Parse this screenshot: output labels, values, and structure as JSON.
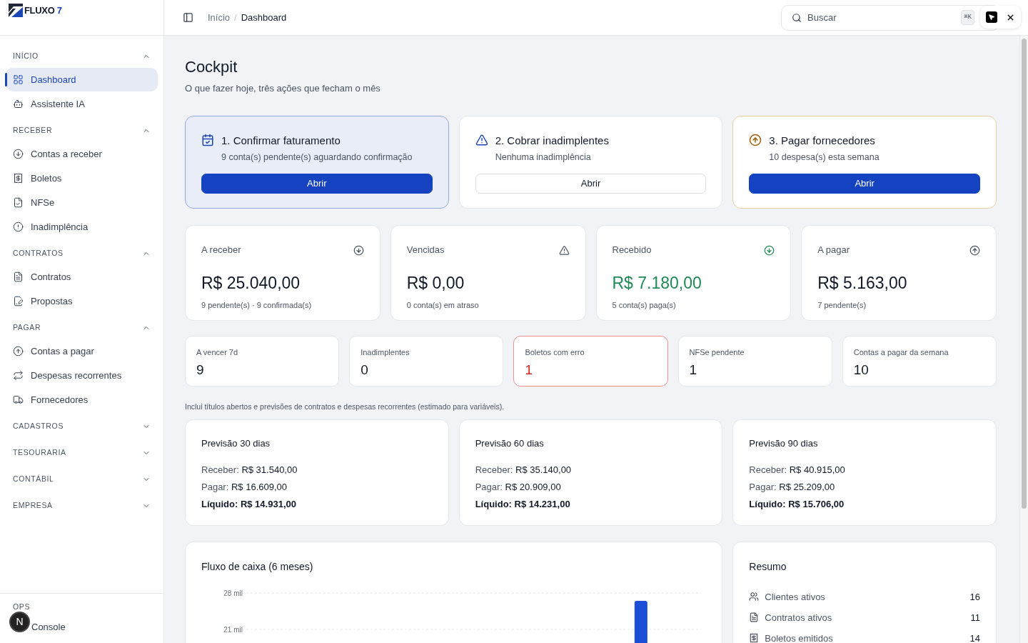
{
  "sidebar": {
    "logo": {
      "name": "FLUXO",
      "accent": "7"
    },
    "sections": [
      {
        "title": "INÍCIO",
        "expanded": true,
        "items": [
          {
            "label": "Dashboard",
            "selected": true
          },
          {
            "label": "Assistente IA",
            "selected": false
          }
        ]
      },
      {
        "title": "RECEBER",
        "expanded": true,
        "items": [
          {
            "label": "Contas a receber",
            "selected": false
          },
          {
            "label": "Boletos",
            "selected": false
          },
          {
            "label": "NFSe",
            "selected": false
          },
          {
            "label": "Inadimplência",
            "selected": false
          }
        ]
      },
      {
        "title": "CONTRATOS",
        "expanded": true,
        "items": [
          {
            "label": "Contratos",
            "selected": false
          },
          {
            "label": "Propostas",
            "selected": false
          }
        ]
      },
      {
        "title": "PAGAR",
        "expanded": true,
        "items": [
          {
            "label": "Contas a pagar",
            "selected": false
          },
          {
            "label": "Despesas recorrentes",
            "selected": false
          },
          {
            "label": "Fornecedores",
            "selected": false
          }
        ]
      },
      {
        "title": "CADASTROS",
        "expanded": false
      },
      {
        "title": "TESOURARIA",
        "expanded": false
      },
      {
        "title": "CONTÁBIL",
        "expanded": false
      },
      {
        "title": "EMPRESA",
        "expanded": false
      }
    ],
    "footer": {
      "title": "OPS",
      "item": "Console"
    },
    "dev_badge": "N"
  },
  "header": {
    "breadcrumbs": [
      "Início",
      "Dashboard"
    ],
    "breadcrumb_separator": "/",
    "search": {
      "placeholder": "Buscar",
      "shortcut": "⌘K"
    }
  },
  "page": {
    "title": "Cockpit",
    "subtitle": "O que fazer hoje, três ações que fecham o mês"
  },
  "actions": [
    {
      "title": "1. Confirmar faturamento",
      "subtitle": "9 conta(s) pendente(s) aguardando confirmação",
      "button": "Abrir",
      "kind": "primary"
    },
    {
      "title": "2. Cobrar inadimplentes",
      "subtitle": "Nenhuma inadimplência",
      "button": "Abrir",
      "kind": "neutral"
    },
    {
      "title": "3. Pagar fornecedores",
      "subtitle": "10 despesa(s) esta semana",
      "button": "Abrir",
      "kind": "warning"
    }
  ],
  "kpis": [
    {
      "label": "A receber",
      "value": "R$ 25.040,00",
      "note": "9 pendente(s) · 9 confirmada(s)",
      "positive": false
    },
    {
      "label": "Vencidas",
      "value": "R$ 0,00",
      "note": "0 conta(s) em atraso",
      "positive": false
    },
    {
      "label": "Recebido",
      "value": "R$ 7.180,00",
      "note": "5 conta(s) paga(s)",
      "positive": true
    },
    {
      "label": "A pagar",
      "value": "R$ 5.163,00",
      "note": "7 pendente(s)",
      "positive": false
    }
  ],
  "counters": [
    {
      "label": "A vencer 7d",
      "value": "9",
      "alert": false
    },
    {
      "label": "Inadimplentes",
      "value": "0",
      "alert": false
    },
    {
      "label": "Boletos com erro",
      "value": "1",
      "alert": true
    },
    {
      "label": "NFSe pendente",
      "value": "1",
      "alert": false
    },
    {
      "label": "Contas a pagar da semana",
      "value": "10",
      "alert": false
    }
  ],
  "forecast_note": "Inclui títulos abertos e previsões de contratos e despesas recorrentes (estimado para variáveis).",
  "forecasts": [
    {
      "title": "Previsão 30 dias",
      "lines": [
        {
          "label": "Receber:",
          "value": "R$ 31.540,00",
          "kind": "normal"
        },
        {
          "label": "Pagar:",
          "value": "R$ 16.609,00",
          "kind": "normal"
        },
        {
          "label": "Líquido:",
          "value": "R$ 14.931,00",
          "kind": "total"
        }
      ]
    },
    {
      "title": "Previsão 60 dias",
      "lines": [
        {
          "label": "Receber:",
          "value": "R$ 35.140,00",
          "kind": "normal"
        },
        {
          "label": "Pagar:",
          "value": "R$ 20.909,00",
          "kind": "normal"
        },
        {
          "label": "Líquido:",
          "value": "R$ 14.231,00",
          "kind": "total"
        }
      ]
    },
    {
      "title": "Previsão 90 dias",
      "lines": [
        {
          "label": "Receber:",
          "value": "R$ 40.915,00",
          "kind": "normal"
        },
        {
          "label": "Pagar:",
          "value": "R$ 25.209,00",
          "kind": "normal"
        },
        {
          "label": "Líquido:",
          "value": "R$ 15.706,00",
          "kind": "total"
        }
      ]
    }
  ],
  "cashflow": {
    "title": "Fluxo de caixa (6 meses)",
    "chart_data": {
      "type": "bar",
      "values": [
        null,
        null,
        null,
        null,
        null,
        26.5
      ],
      "ylim": [
        0,
        28
      ],
      "yticks": [
        {
          "value": 21,
          "label": "21 mil"
        },
        {
          "value": 28,
          "label": "28 mil"
        }
      ]
    }
  },
  "summary": {
    "title": "Resumo",
    "rows": [
      {
        "label": "Clientes ativos",
        "value": "16"
      },
      {
        "label": "Contratos ativos",
        "value": "11"
      },
      {
        "label": "Boletos emitidos",
        "value": "14"
      }
    ]
  }
}
